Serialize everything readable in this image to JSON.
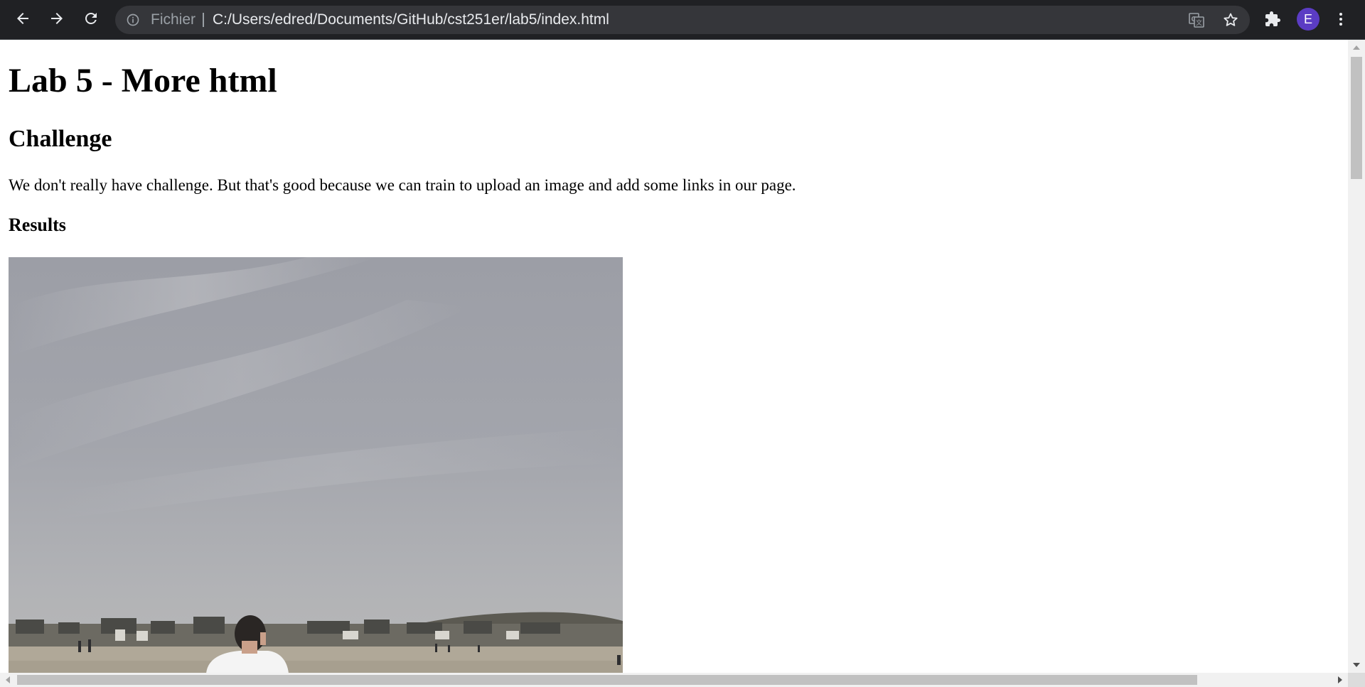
{
  "browser": {
    "scheme_label": "Fichier",
    "url": "C:/Users/edred/Documents/GitHub/cst251er/lab5/index.html",
    "profile_initial": "E",
    "icons": [
      "back-icon",
      "forward-icon",
      "reload-icon",
      "info-icon",
      "translate-icon",
      "star-icon",
      "extensions-icon",
      "menu-icon"
    ],
    "colors": {
      "toolbar": "#202124",
      "omnibox": "#35363a",
      "avatar": "#5b3cc4"
    }
  },
  "page": {
    "title": "Lab 5 - More html",
    "challenge_heading": "Challenge",
    "challenge_text": "We don't really have challenge. But that's good because we can train to upload an image and add some links in our page.",
    "results_heading": "Results"
  }
}
